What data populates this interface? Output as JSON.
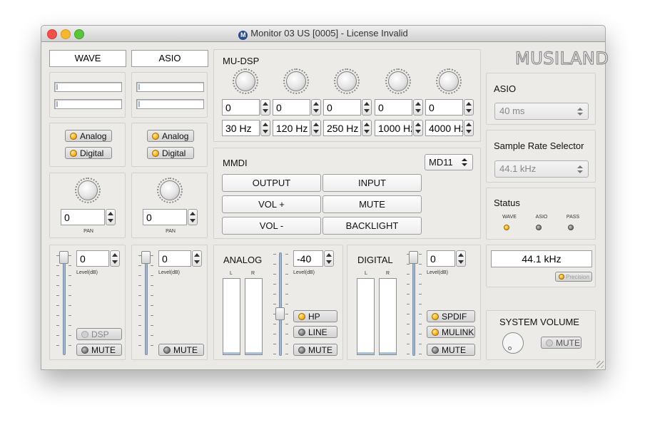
{
  "window": {
    "title": "Monitor 03 US [0005] - License Invalid",
    "app_icon": "M"
  },
  "brand": {
    "logo": "MUSILAND"
  },
  "wave": {
    "tab": "WAVE",
    "analog": "Analog",
    "digital": "Digital",
    "pan_value": "0",
    "pan_label": "PAN",
    "level_value": "0",
    "level_label": "Level(dB)",
    "dsp": "DSP",
    "mute": "MUTE"
  },
  "asio_ch": {
    "tab": "ASIO",
    "analog": "Analog",
    "digital": "Digital",
    "pan_value": "0",
    "pan_label": "PAN",
    "level_value": "0",
    "level_label": "Level(dB)",
    "mute": "MUTE"
  },
  "mudsp": {
    "title": "MU-DSP",
    "gains": [
      "0",
      "0",
      "0",
      "0",
      "0"
    ],
    "freqs": [
      "30 Hz",
      "120 Hz",
      "250 Hz",
      "1000 Hz",
      "4000 Hz"
    ]
  },
  "mmdi": {
    "title": "MMDI",
    "model": "MD11",
    "buttons": [
      "OUTPUT",
      "INPUT",
      "VOL +",
      "MUTE",
      "VOL -",
      "BACKLIGHT"
    ]
  },
  "analog": {
    "title": "ANALOG",
    "level_value": "-40",
    "level_label": "Level(dB)",
    "meter_l": "L",
    "meter_r": "R",
    "hp": "HP",
    "line": "LINE",
    "mute": "MUTE"
  },
  "digital": {
    "title": "DIGITAL",
    "level_value": "0",
    "level_label": "Level(dB)",
    "meter_l": "L",
    "meter_r": "R",
    "spdif": "SPDIF",
    "mulink": "MULINK",
    "mute": "MUTE"
  },
  "asio": {
    "title": "ASIO",
    "latency": "40 ms"
  },
  "sample_rate": {
    "title": "Sample Rate Selector",
    "value": "44.1 kHz"
  },
  "status": {
    "title": "Status",
    "labels": [
      "WAVE",
      "ASIO",
      "PASS"
    ]
  },
  "rate_display": {
    "value": "44.1 kHz",
    "precision": "Precision"
  },
  "system_volume": {
    "title": "SYSTEM VOLUME",
    "mute": "MUTE"
  }
}
